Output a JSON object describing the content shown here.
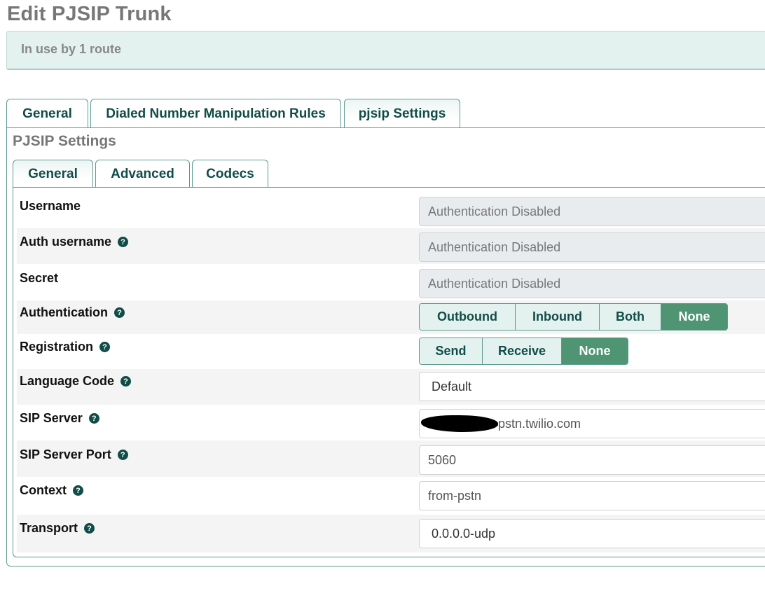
{
  "page": {
    "title": "Edit PJSIP Trunk"
  },
  "alert": {
    "text": "In use by 1 route"
  },
  "top_tabs": [
    {
      "label": "General"
    },
    {
      "label": "Dialed Number Manipulation Rules"
    },
    {
      "label": "pjsip Settings",
      "active": true
    }
  ],
  "section": {
    "title": "PJSIP Settings"
  },
  "sub_tabs": [
    {
      "label": "General",
      "active": true
    },
    {
      "label": "Advanced"
    },
    {
      "label": "Codecs"
    }
  ],
  "form": {
    "username": {
      "label": "Username",
      "value": "Authentication Disabled"
    },
    "auth_username": {
      "label": "Auth username",
      "value": "Authentication Disabled"
    },
    "secret": {
      "label": "Secret",
      "value": "Authentication Disabled"
    },
    "authentication": {
      "label": "Authentication",
      "options": [
        "Outbound",
        "Inbound",
        "Both",
        "None"
      ],
      "selected": "None"
    },
    "registration": {
      "label": "Registration",
      "options": [
        "Send",
        "Receive",
        "None"
      ],
      "selected": "None"
    },
    "language_code": {
      "label": "Language Code",
      "value": "Default"
    },
    "sip_server": {
      "label": "SIP Server",
      "value_visible": "pstn.twilio.com"
    },
    "sip_server_port": {
      "label": "SIP Server Port",
      "value": "5060"
    },
    "context": {
      "label": "Context",
      "value": "from-pstn"
    },
    "transport": {
      "label": "Transport",
      "value": "0.0.0.0-udp"
    }
  },
  "icons": {
    "help": "question-circle-icon"
  },
  "colors": {
    "accent": "#114d48",
    "active_button": "#4f9473",
    "alert_bg": "#e3f1ef"
  }
}
